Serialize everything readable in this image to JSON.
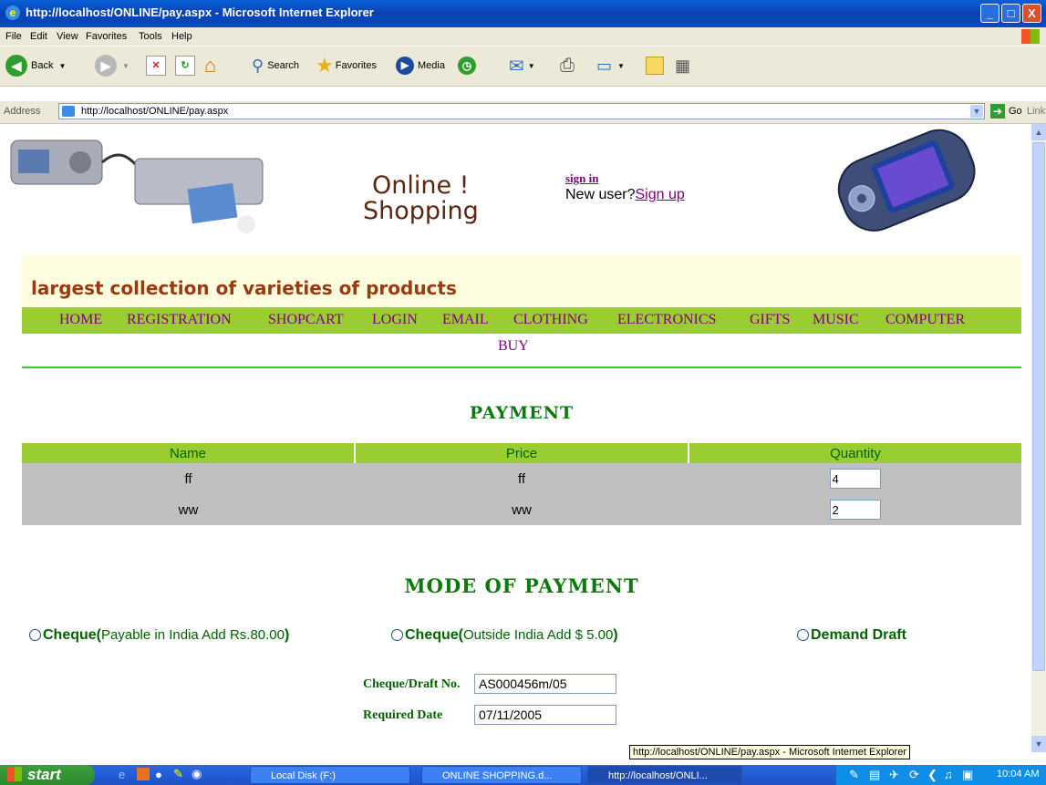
{
  "window": {
    "title": "http://localhost/ONLINE/pay.aspx - Microsoft Internet Explorer",
    "minimize": "_",
    "maximize": "□",
    "close": "X"
  },
  "menu": [
    "File",
    "Edit",
    "View",
    "Favorites",
    "Tools",
    "Help"
  ],
  "toolbar": {
    "back": "Back",
    "search": "Search",
    "favorites": "Favorites",
    "media": "Media"
  },
  "address": {
    "label": "Address",
    "url": "http://localhost/ONLINE/pay.aspx",
    "go": "Go",
    "links": "Links"
  },
  "header": {
    "logo_line1": "Online !",
    "logo_line2": "Shopping",
    "sign_in": "sign in",
    "new_user": "New user?",
    "sign_up": "Sign up",
    "tagline": "largest collection of varieties of products"
  },
  "nav": {
    "items": [
      "HOME",
      "REGISTRATION",
      "SHOPCART",
      "LOGIN",
      "EMAIL",
      "CLOTHING",
      "ELECTRONICS",
      "GIFTS",
      "MUSIC",
      "COMPUTER"
    ],
    "buy": "BUY"
  },
  "payment": {
    "heading": "PAYMENT",
    "columns": [
      "Name",
      "Price",
      "Quantity"
    ],
    "rows": [
      {
        "name": "ff",
        "price": "ff",
        "quantity": "4"
      },
      {
        "name": "ww",
        "price": "ww",
        "quantity": "2"
      }
    ]
  },
  "mode": {
    "heading": "MODE OF PAYMENT",
    "options": [
      {
        "bold": "Cheque(",
        "rest": "Payable in India Add Rs.80.00",
        "close": ")"
      },
      {
        "bold": "Cheque(",
        "rest": "Outside India Add $ 5.00",
        "close": ")"
      },
      {
        "bold": "Demand Draft",
        "rest": "",
        "close": ""
      }
    ],
    "cheque_label": "Cheque/Draft No.",
    "cheque_value": "AS000456m/05",
    "date_label": "Required Date",
    "date_value": "07/11/2005"
  },
  "status_tooltip": "http://localhost/ONLINE/pay.aspx - Microsoft Internet Explorer",
  "taskbar": {
    "start": "start",
    "tasks": [
      "Local Disk (F:)",
      "ONLINE SHOPPING.d...",
      "http://localhost/ONLI..."
    ],
    "clock": "10:04 AM"
  }
}
